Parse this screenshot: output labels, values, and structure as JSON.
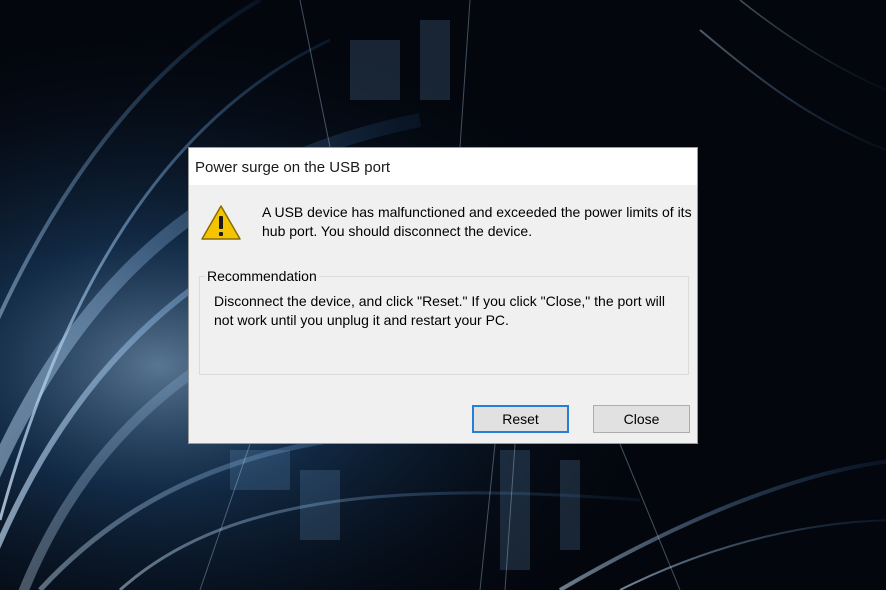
{
  "dialog": {
    "title": "Power surge on the USB port",
    "message": "A USB device has malfunctioned and exceeded the power limits of its hub port. You should disconnect the device.",
    "icon": "warning-icon",
    "group_label": "Recommendation",
    "recommendation": "Disconnect the device, and click \"Reset.\" If you click \"Close,\" the port will not work until you unplug it and restart your PC.",
    "buttons": {
      "reset_label": "Reset",
      "close_label": "Close"
    }
  },
  "colors": {
    "desktop_background": "#03060d",
    "accent_light_streaks": "#4a9be0",
    "dialog_background": "#f0f0f0",
    "default_button_border": "#2a7dd6",
    "warning_yellow": "#f5c400"
  }
}
